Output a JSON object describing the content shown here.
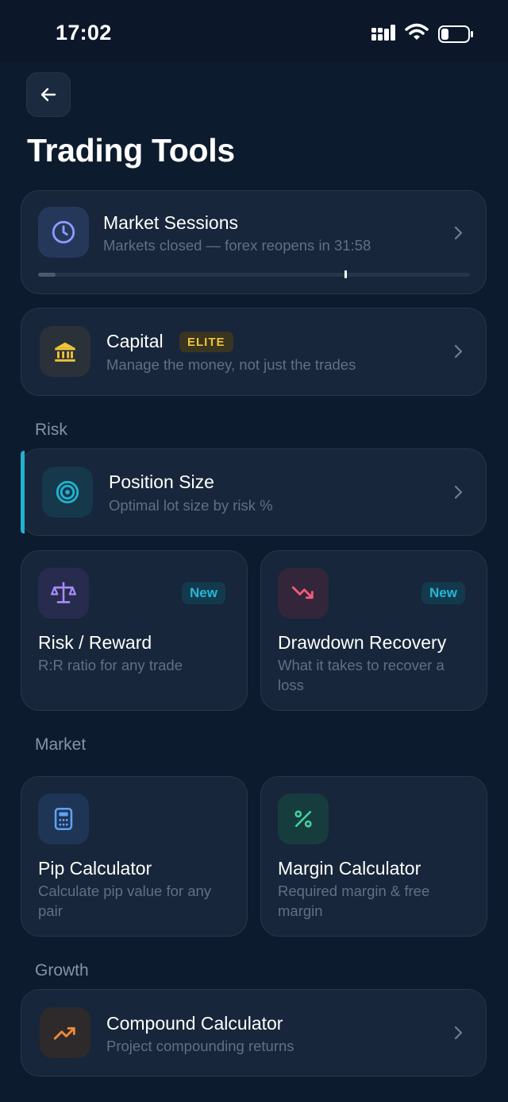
{
  "status_bar": {
    "time": "17:02"
  },
  "header": {
    "title": "Trading Tools"
  },
  "market_sessions": {
    "title": "Market Sessions",
    "subtitle": "Markets closed — forex reopens in 31:58",
    "progress_fraction": 0.04,
    "icon": "clock-icon"
  },
  "capital": {
    "title": "Capital",
    "badge": "ELITE",
    "subtitle": "Manage the money, not just the trades",
    "icon": "bank-icon"
  },
  "sections": {
    "risk": "Risk",
    "market": "Market",
    "growth": "Growth"
  },
  "position_size": {
    "title": "Position Size",
    "subtitle": "Optimal lot size by risk %",
    "icon": "target-icon"
  },
  "risk_reward": {
    "title": "Risk / Reward",
    "subtitle": "R:R ratio for any trade",
    "badge": "New",
    "icon": "scale-icon"
  },
  "drawdown": {
    "title": "Drawdown Recovery",
    "subtitle": "What it takes to recover a loss",
    "badge": "New",
    "icon": "trending-down-icon"
  },
  "pip_calculator": {
    "title": "Pip Calculator",
    "subtitle": "Calculate pip value for any pair",
    "icon": "calculator-icon"
  },
  "margin_calculator": {
    "title": "Margin Calculator",
    "subtitle": "Required margin & free margin",
    "icon": "percent-icon"
  },
  "compound_calculator": {
    "title": "Compound Calculator",
    "subtitle": "Project compounding returns",
    "icon": "trending-up-icon"
  },
  "colors": {
    "background": "#0d1b2e",
    "card": "#17263a",
    "accent_cyan": "#1fb3d1",
    "elite_gold": "#f0c43a",
    "muted_text": "#5f7086"
  }
}
